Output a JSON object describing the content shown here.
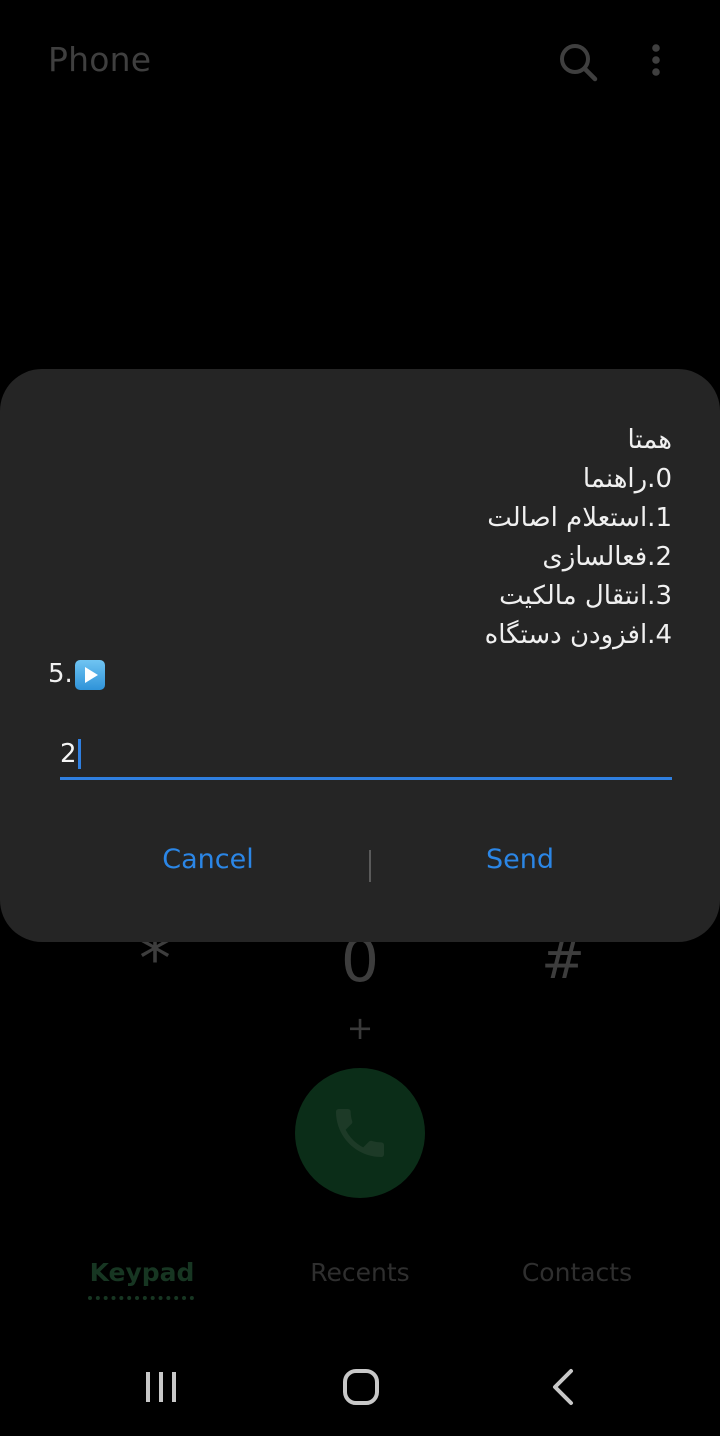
{
  "app_bar": {
    "title": "Phone",
    "search_icon": "search-icon",
    "more_icon": "more-vertical-icon"
  },
  "keypad": {
    "star": "*",
    "zero": "0",
    "zero_sub": "+",
    "hash": "#",
    "call_icon": "phone-handset-icon",
    "call_color": "#0b2d18"
  },
  "tabs": [
    {
      "label": "Keypad",
      "active": true
    },
    {
      "label": "Recents",
      "active": false
    },
    {
      "label": "Contacts",
      "active": false
    }
  ],
  "ussd_dialog": {
    "lines": [
      "همتا",
      "0.راهنما",
      "1.استعلام اصالت",
      "2.فعالسازی",
      "3.انتقال مالکیت",
      "4.افزودن دستگاه"
    ],
    "last_line_prefix": "5.",
    "last_line_icon": "play-button-icon",
    "input_value": "2",
    "cancel_label": "Cancel",
    "send_label": "Send",
    "accent_color": "#2b86e6"
  },
  "nav_bar": {
    "recent_icon": "recent-apps-icon",
    "home_icon": "home-icon",
    "back_icon": "back-icon"
  }
}
